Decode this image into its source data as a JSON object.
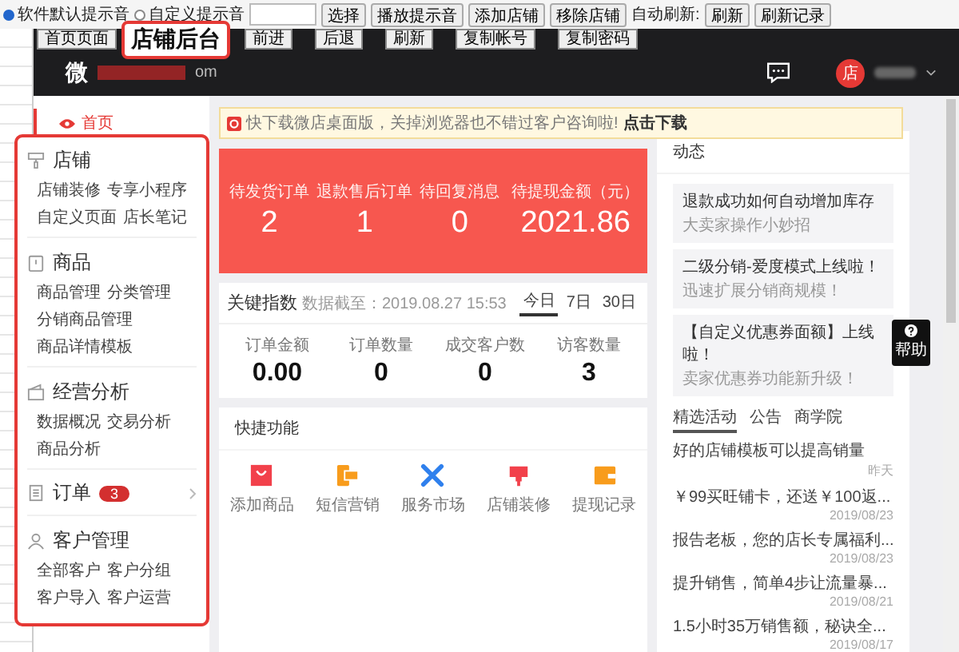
{
  "toolbar": {
    "sound_options": [
      {
        "label": "软件默认提示音",
        "selected": true
      },
      {
        "label": "自定义提示音",
        "selected": false
      }
    ],
    "buttons": [
      "选择",
      "播放提示音",
      "添加店铺",
      "移除店铺"
    ],
    "auto_refresh_label": "自动刷新:",
    "refresh_buttons": [
      "刷新",
      "刷新记录"
    ]
  },
  "browser_buttons": [
    "首页页面",
    "前进",
    "后退",
    "刷新",
    "复制帐号",
    "复制密码"
  ],
  "callout": "店铺后台",
  "header": {
    "logo": "微",
    "logo_suffix": "om",
    "avatar": "店"
  },
  "sidebar": {
    "items": [
      {
        "label": "首页",
        "selected": true
      }
    ]
  },
  "menu": [
    {
      "title": "店铺",
      "links": [
        "店铺装修",
        "专享小程序",
        "自定义页面",
        "店长笔记"
      ]
    },
    {
      "title": "商品",
      "links": [
        "商品管理",
        "分类管理",
        "分销商品管理",
        "商品详情模板"
      ]
    },
    {
      "title": "经营分析",
      "links": [
        "数据概况",
        "交易分析",
        "商品分析"
      ]
    },
    {
      "title": "订单",
      "badge": "3"
    },
    {
      "title": "客户管理",
      "links": [
        "全部客户",
        "客户分组",
        "客户导入",
        "客户运营"
      ]
    }
  ],
  "notice": {
    "text": "快下载微店桌面版，关掉浏览器也不错过客户咨询啦!",
    "link": "点击下载"
  },
  "stats": [
    {
      "label": "待发货订单",
      "value": "2"
    },
    {
      "label": "退款售后订单",
      "value": "1"
    },
    {
      "label": "待回复消息",
      "value": "0"
    },
    {
      "label": "待提现金额（元）",
      "value": "2021.86"
    }
  ],
  "key_metrics": {
    "title": "关键指数",
    "updated": "数据截至：2019.08.27 15:53",
    "ranges": [
      {
        "label": "今日",
        "selected": true
      },
      {
        "label": "7日",
        "selected": false
      },
      {
        "label": "30日",
        "selected": false
      }
    ],
    "metrics": [
      {
        "label": "订单金额",
        "value": "0.00"
      },
      {
        "label": "订单数量",
        "value": "0"
      },
      {
        "label": "成交客户数",
        "value": "0"
      },
      {
        "label": "访客数量",
        "value": "3"
      }
    ]
  },
  "quick": {
    "title": "快捷功能",
    "items": [
      {
        "label": "添加商品",
        "kind": "bag"
      },
      {
        "label": "短信营销",
        "kind": "sms"
      },
      {
        "label": "服务市场",
        "kind": "tools"
      },
      {
        "label": "店铺装修",
        "kind": "brush"
      },
      {
        "label": "提现记录",
        "kind": "wallet"
      }
    ]
  },
  "news": {
    "title": "动态",
    "cards": [
      {
        "title": "退款成功如何自动增加库存",
        "sub": "大卖家操作小妙招"
      },
      {
        "title": "二级分销-爱度模式上线啦！",
        "sub": "迅速扩展分销商规模！"
      },
      {
        "title": "【自定义优惠券面额】上线啦！",
        "sub": "卖家优惠券功能新升级！"
      }
    ],
    "tabs": [
      {
        "label": "精选活动",
        "selected": true
      },
      {
        "label": "公告",
        "selected": false
      },
      {
        "label": "商学院",
        "selected": false
      }
    ],
    "items": [
      {
        "title": "好的店铺模板可以提高销量",
        "date": "昨天"
      },
      {
        "title": "￥99买旺铺卡，还送￥100返...",
        "date": "2019/08/23"
      },
      {
        "title": "报告老板，您的店长专属福利...",
        "date": "2019/08/23"
      },
      {
        "title": "提升销售，简单4步让流量暴...",
        "date": "2019/08/21"
      },
      {
        "title": "1.5小时35万销售额，秘诀全...",
        "date": "2019/08/17"
      }
    ]
  },
  "help": "帮助"
}
